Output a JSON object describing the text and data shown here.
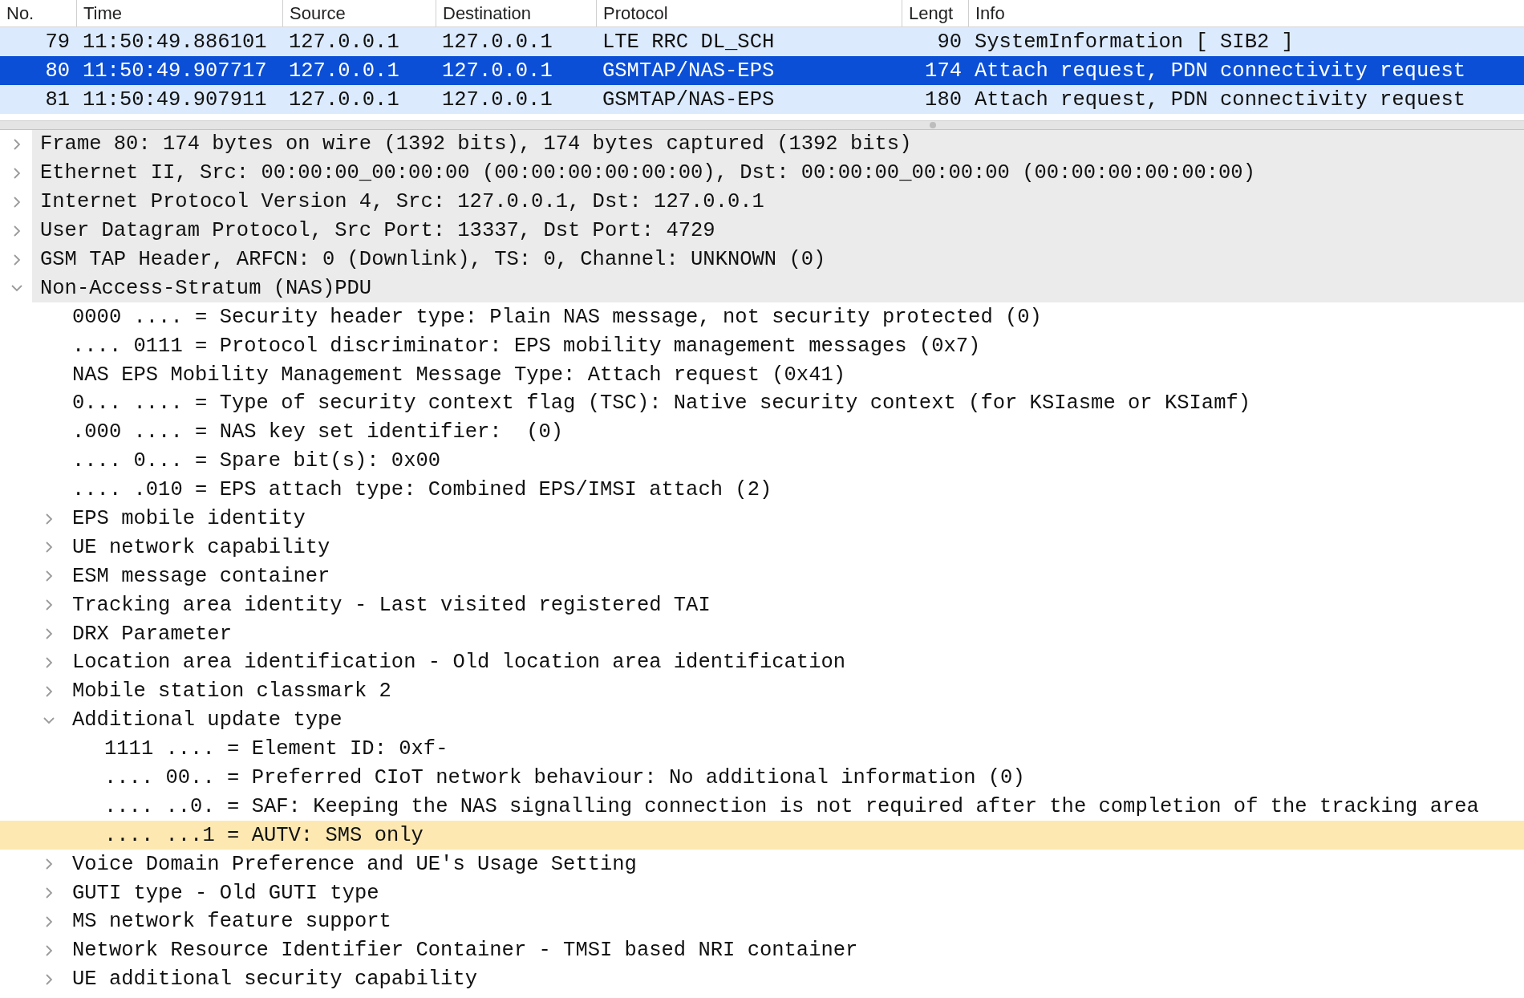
{
  "packet_list": {
    "columns": [
      "No.",
      "Time",
      "Source",
      "Destination",
      "Protocol",
      "Lengt",
      "Info"
    ],
    "rows": [
      {
        "no": "79",
        "time": "11:50:49.886101",
        "source": "127.0.0.1",
        "destination": "127.0.0.1",
        "protocol": "LTE RRC DL_SCH",
        "length": "90",
        "info": "SystemInformation [ SIB2 ]",
        "selected": false
      },
      {
        "no": "80",
        "time": "11:50:49.907717",
        "source": "127.0.0.1",
        "destination": "127.0.0.1",
        "protocol": "GSMTAP/NAS-EPS",
        "length": "174",
        "info": "Attach request, PDN connectivity request",
        "selected": true
      },
      {
        "no": "81",
        "time": "11:50:49.907911",
        "source": "127.0.0.1",
        "destination": "127.0.0.1",
        "protocol": "GSMTAP/NAS-EPS",
        "length": "180",
        "info": "Attach request, PDN connectivity request",
        "selected": false
      }
    ]
  },
  "packet_details": [
    {
      "kind": "subtree",
      "text": "Frame 80: 174 bytes on wire (1392 bits), 174 bytes captured (1392 bits)",
      "expanded": false,
      "selected": false
    },
    {
      "kind": "subtree",
      "text": "Ethernet II, Src: 00:00:00_00:00:00 (00:00:00:00:00:00), Dst: 00:00:00_00:00:00 (00:00:00:00:00:00)",
      "expanded": false,
      "selected": false
    },
    {
      "kind": "subtree",
      "text": "Internet Protocol Version 4, Src: 127.0.0.1, Dst: 127.0.0.1",
      "expanded": false,
      "selected": false
    },
    {
      "kind": "subtree",
      "text": "User Datagram Protocol, Src Port: 13337, Dst Port: 4729",
      "expanded": false,
      "selected": false
    },
    {
      "kind": "subtree",
      "text": "GSM TAP Header, ARFCN: 0 (Downlink), TS: 0, Channel: UNKNOWN (0)",
      "expanded": false,
      "selected": false
    },
    {
      "kind": "subtree",
      "text": "Non-Access-Stratum (NAS)PDU",
      "expanded": true,
      "selected": false,
      "children": [
        {
          "text": "0000 .... = Security header type: Plain NAS message, not security protected (0)",
          "selected": false
        },
        {
          "text": ".... 0111 = Protocol discriminator: EPS mobility management messages (0x7)",
          "selected": false
        },
        {
          "text": "NAS EPS Mobility Management Message Type: Attach request (0x41)",
          "selected": false
        },
        {
          "text": "0... .... = Type of security context flag (TSC): Native security context (for KSIasme or KSIamf)",
          "selected": false
        },
        {
          "text": ".000 .... = NAS key set identifier:  (0)",
          "selected": false
        },
        {
          "text": ".... 0... = Spare bit(s): 0x00",
          "selected": false
        },
        {
          "text": ".... .010 = EPS attach type: Combined EPS/IMSI attach (2)",
          "selected": false
        },
        {
          "kind": "subtree",
          "text": "EPS mobile identity",
          "expanded": false,
          "selected": false
        },
        {
          "kind": "subtree",
          "text": "UE network capability",
          "expanded": false,
          "selected": false
        },
        {
          "kind": "subtree",
          "text": "ESM message container",
          "expanded": false,
          "selected": false
        },
        {
          "kind": "subtree",
          "text": "Tracking area identity - Last visited registered TAI",
          "expanded": false,
          "selected": false
        },
        {
          "kind": "subtree",
          "text": "DRX Parameter",
          "expanded": false,
          "selected": false
        },
        {
          "kind": "subtree",
          "text": "Location area identification - Old location area identification",
          "expanded": false,
          "selected": false
        },
        {
          "kind": "subtree",
          "text": "Mobile station classmark 2",
          "expanded": false,
          "selected": false
        },
        {
          "kind": "subtree",
          "text": "Additional update type",
          "expanded": true,
          "selected": false,
          "children": [
            {
              "text": "1111 .... = Element ID: 0xf-",
              "selected": false
            },
            {
              "text": ".... 00.. = Preferred CIoT network behaviour: No additional information (0)",
              "selected": false
            },
            {
              "text": ".... ..0. = SAF: Keeping the NAS signalling connection is not required after the completion of the tracking area",
              "selected": false
            },
            {
              "text": ".... ...1 = AUTV: SMS only",
              "selected": true
            }
          ]
        },
        {
          "kind": "subtree",
          "text": "Voice Domain Preference and UE's Usage Setting",
          "expanded": false,
          "selected": false
        },
        {
          "kind": "subtree",
          "text": "GUTI type - Old GUTI type",
          "expanded": false,
          "selected": false
        },
        {
          "kind": "subtree",
          "text": "MS network feature support",
          "expanded": false,
          "selected": false
        },
        {
          "kind": "subtree",
          "text": "Network Resource Identifier Container - TMSI based NRI container",
          "expanded": false,
          "selected": false
        },
        {
          "kind": "subtree",
          "text": "UE additional security capability",
          "expanded": false,
          "selected": false
        }
      ]
    }
  ]
}
